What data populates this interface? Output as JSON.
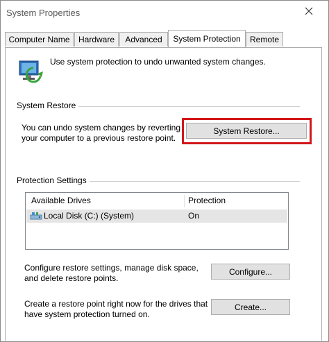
{
  "window": {
    "title": "System Properties"
  },
  "tabs": [
    {
      "label": "Computer Name"
    },
    {
      "label": "Hardware"
    },
    {
      "label": "Advanced"
    },
    {
      "label": "System Protection"
    },
    {
      "label": "Remote"
    }
  ],
  "intro": {
    "text": "Use system protection to undo unwanted system changes."
  },
  "system_restore": {
    "group_label": "System Restore",
    "description_line1": "You can undo system changes by reverting",
    "description_line2": "your computer to a previous restore point.",
    "button_label": "System Restore..."
  },
  "protection": {
    "group_label": "Protection Settings",
    "columns": [
      "Available Drives",
      "Protection"
    ],
    "rows": [
      {
        "drive": "Local Disk (C:) (System)",
        "protection": "On"
      }
    ]
  },
  "configure": {
    "line1": "Configure restore settings, manage disk space,",
    "line2": "and delete restore points.",
    "button_label": "Configure..."
  },
  "create": {
    "line1": "Create a restore point right now for the drives that",
    "line2": "have system protection turned on.",
    "button_label": "Create..."
  },
  "colors": {
    "highlight": "#d2161a",
    "selected_row": "#e5e5e5"
  }
}
